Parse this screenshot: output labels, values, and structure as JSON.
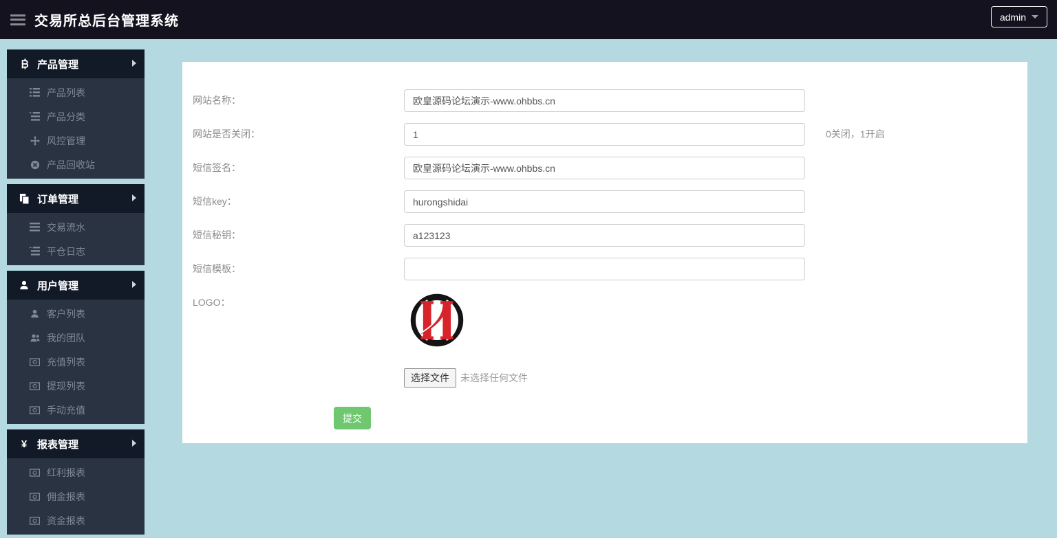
{
  "topbar": {
    "title": "交易所总后台管理系统",
    "user": "admin"
  },
  "sidebar": {
    "sections": [
      {
        "title": "产品管理",
        "items": [
          {
            "label": "产品列表"
          },
          {
            "label": "产品分类"
          },
          {
            "label": "风控管理"
          },
          {
            "label": "产品回收站"
          }
        ]
      },
      {
        "title": "订单管理",
        "items": [
          {
            "label": "交易流水"
          },
          {
            "label": "平仓日志"
          }
        ]
      },
      {
        "title": "用户管理",
        "items": [
          {
            "label": "客户列表"
          },
          {
            "label": "我的团队"
          },
          {
            "label": "充值列表"
          },
          {
            "label": "提现列表"
          },
          {
            "label": "手动充值"
          }
        ]
      },
      {
        "title": "报表管理",
        "yen_glyph": "¥",
        "items": [
          {
            "label": "红利报表"
          },
          {
            "label": "佣金报表"
          },
          {
            "label": "资金报表"
          }
        ]
      }
    ]
  },
  "form": {
    "fields": [
      {
        "label": "网站名称：",
        "value": "欧皇源码论坛演示-www.ohbbs.cn"
      },
      {
        "label": "网站是否关闭：",
        "value": "1",
        "hint": "0关闭，1开启"
      },
      {
        "label": "短信签名：",
        "value": "欧皇源码论坛演示-www.ohbbs.cn"
      },
      {
        "label": "短信key：",
        "value": "hurongshidai"
      },
      {
        "label": "短信秘钥：",
        "value": "a123123"
      },
      {
        "label": "短信模板：",
        "value": ""
      }
    ],
    "logo_label": "LOGO：",
    "file_button": "选择文件",
    "file_status": "未选择任何文件",
    "submit_label": "提交"
  },
  "colors": {
    "topbar_bg": "#15121f",
    "menu_header_bg": "#131a27",
    "submenu_bg": "#2a3341",
    "page_bg": "#b5d9e1",
    "submit_green": "#6fc76f",
    "logo_red": "#d8232a"
  }
}
